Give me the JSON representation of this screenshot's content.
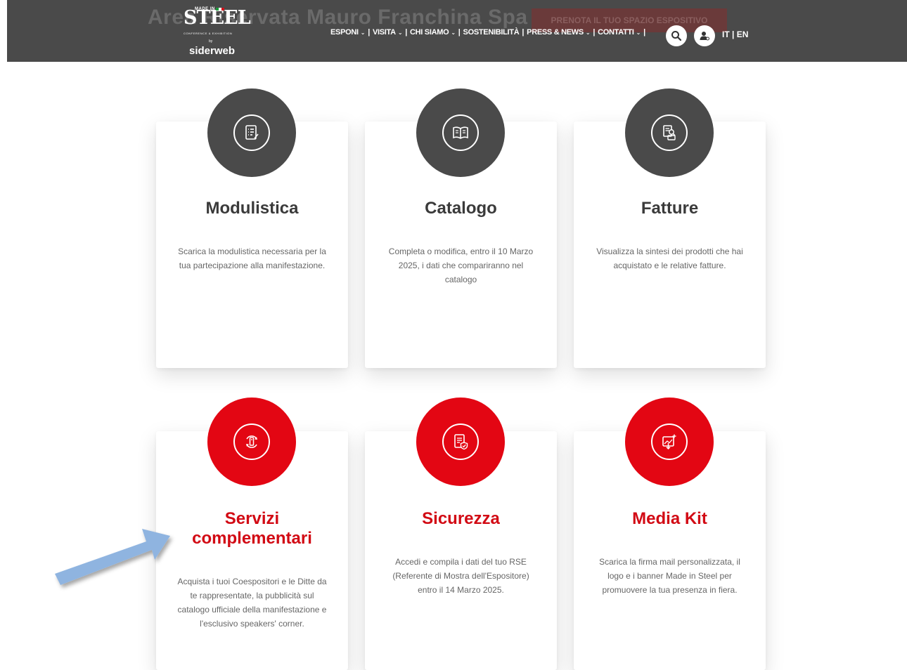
{
  "header": {
    "background_title": "Area Riservata Mauro Franchina Spa",
    "cta_button": "PRENOTA IL TUO SPAZIO ESPOSITIVO",
    "logo": {
      "made_in": "MADE IN",
      "brand": "STEEL",
      "tagline": "CONFERENCE & EXHIBITION",
      "by": "by",
      "partner": "siderweb"
    },
    "nav": [
      {
        "label": "ESPONI",
        "has_dropdown": true
      },
      {
        "label": "VISITA",
        "has_dropdown": true
      },
      {
        "label": "CHI SIAMO",
        "has_dropdown": true
      },
      {
        "label": "SOSTENIBILITÀ",
        "has_dropdown": false
      },
      {
        "label": "PRESS & NEWS",
        "has_dropdown": true
      },
      {
        "label": "CONTATTI",
        "has_dropdown": true
      }
    ],
    "search_icon": "search-icon",
    "user_icon": "user-icon",
    "languages": "IT | EN"
  },
  "cards": [
    {
      "title": "Modulistica",
      "description": "Scarica la modulistica necessaria per la tua partecipazione alla manifestazione.",
      "icon": "form-list-icon",
      "theme": "dark"
    },
    {
      "title": "Catalogo",
      "description": "Completa o modifica, entro il 10 Marzo 2025, i dati che compariranno nel catalogo",
      "icon": "open-book-icon",
      "theme": "dark"
    },
    {
      "title": "Fatture",
      "description": "Visualizza la sintesi dei prodotti che hai acquistato e le relative fatture.",
      "icon": "invoice-search-icon",
      "theme": "dark"
    },
    {
      "title": "Servizi complementari",
      "description": "Acquista i tuoi Coespositori e le Ditte da te rappresentate, la pubblicità sul catalogo ufficiale della manifestazione e l'esclusivo speakers' corner.",
      "icon": "services-cycle-icon",
      "theme": "red"
    },
    {
      "title": "Sicurezza",
      "description": "Accedi e compila i dati del tuo RSE (Referente di Mostra dell'Espositore) entro il 14 Marzo 2025.",
      "icon": "document-shield-icon",
      "theme": "red"
    },
    {
      "title": "Media Kit",
      "description": "Scarica la firma mail personalizzata, il logo e i banner Made in Steel per promuovere la tua presenza in fiera.",
      "icon": "image-download-icon",
      "theme": "red"
    }
  ],
  "colors": {
    "header_bg": "#4a4a4a",
    "dark_circle": "#4a4a4a",
    "red_circle": "#e30613",
    "red_title": "#d20a14",
    "annotation_arrow": "#8fb4e0"
  }
}
